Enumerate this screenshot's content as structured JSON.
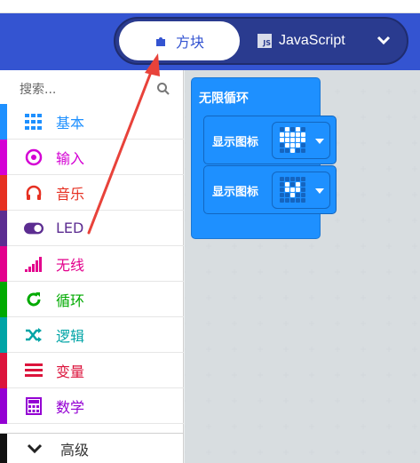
{
  "header": {
    "tabs": [
      {
        "label": "方块",
        "icon": "puzzle-icon",
        "active": true
      },
      {
        "label": "JavaScript",
        "icon": "js-file-icon",
        "active": false
      }
    ],
    "js_badge": "JS",
    "more_icon": "chevron-down-icon"
  },
  "toolbox": {
    "search": {
      "placeholder": "搜索..."
    },
    "categories": [
      {
        "label": "基本",
        "color": "#1e90ff",
        "icon": "grid-icon"
      },
      {
        "label": "输入",
        "color": "#d400d4",
        "icon": "radio-target-icon"
      },
      {
        "label": "音乐",
        "color": "#e63022",
        "icon": "headphones-icon"
      },
      {
        "label": "LED",
        "color": "#5c2d91",
        "icon": "toggle-icon"
      },
      {
        "label": "无线",
        "color": "#e3008c",
        "icon": "signal-bars-icon"
      },
      {
        "label": "循环",
        "color": "#00aa00",
        "icon": "refresh-icon"
      },
      {
        "label": "逻辑",
        "color": "#00a4a6",
        "icon": "shuffle-icon"
      },
      {
        "label": "变量",
        "color": "#dc143c",
        "icon": "lines-icon"
      },
      {
        "label": "数学",
        "color": "#9400d3",
        "icon": "calculator-icon"
      }
    ],
    "advanced": {
      "label": "高级",
      "icon": "chevron-down-icon"
    }
  },
  "workspace": {
    "forever_block": {
      "label": "无限循环"
    },
    "statements": [
      {
        "label": "显示图标",
        "icon": "heart-large"
      },
      {
        "label": "显示图标",
        "icon": "heart-small"
      }
    ]
  }
}
